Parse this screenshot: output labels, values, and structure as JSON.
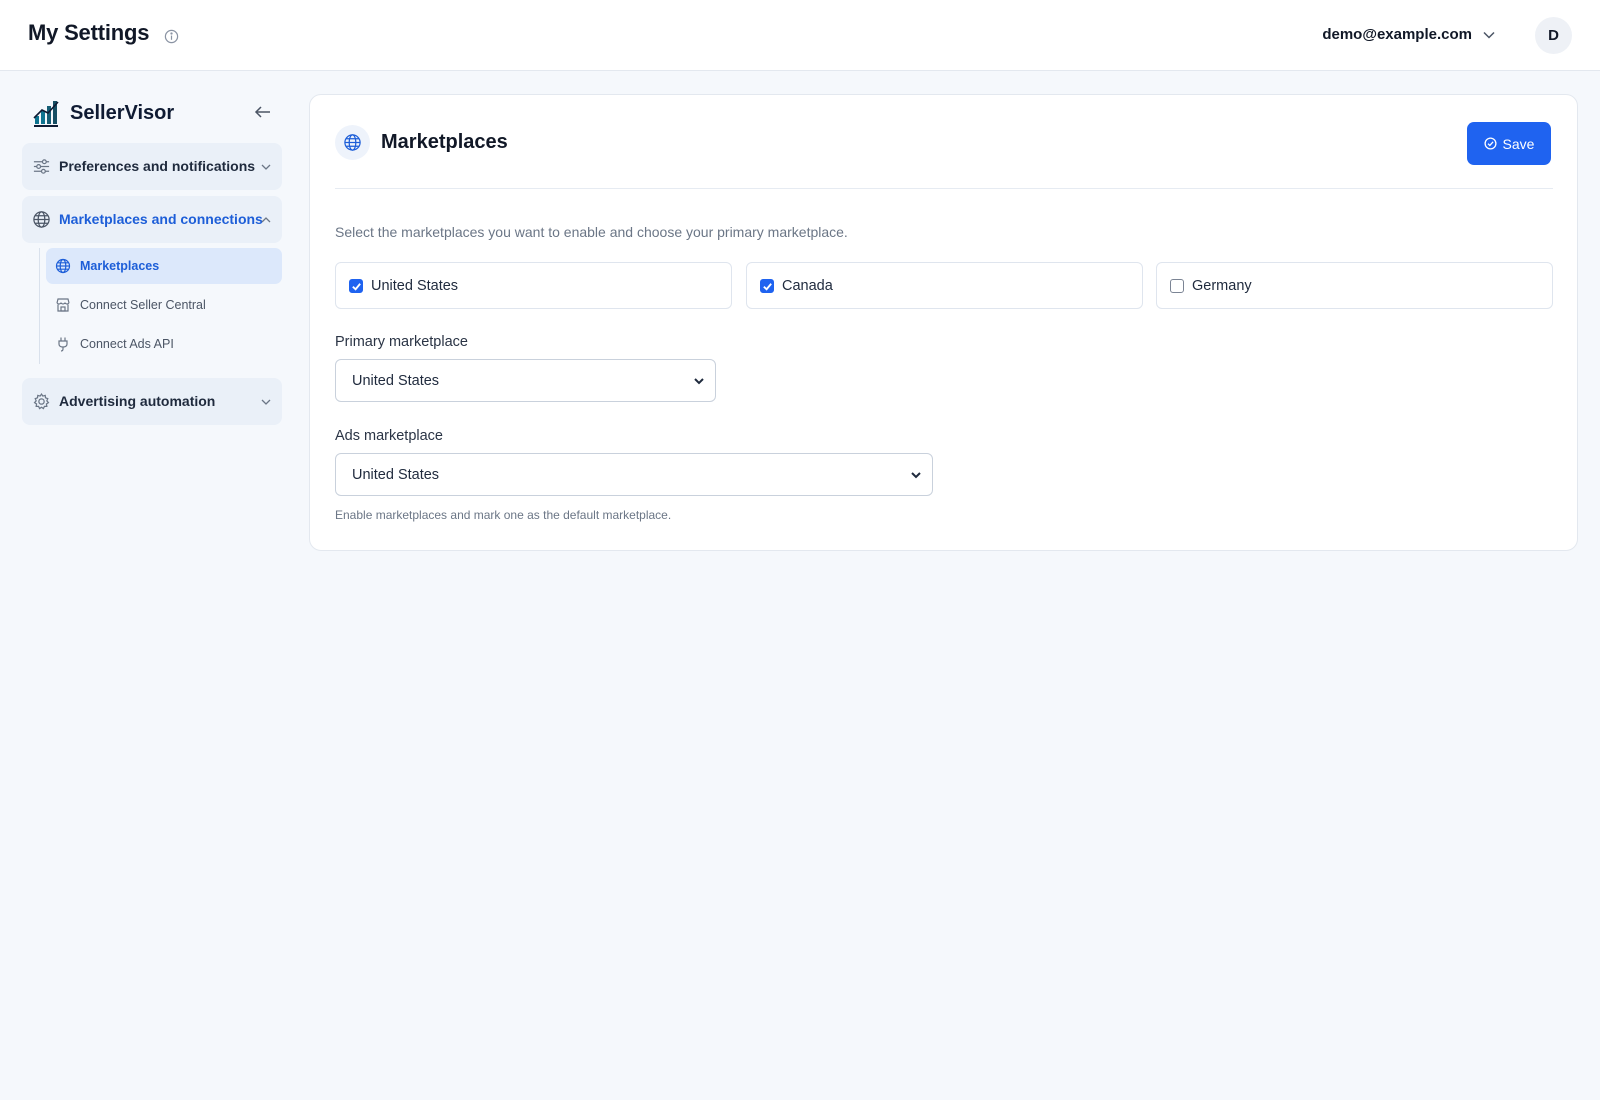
{
  "header": {
    "title": "My Settings",
    "user_email": "demo@example.com",
    "avatar_initial": "D"
  },
  "sidebar": {
    "brand_name": "SellerVisor",
    "groups": [
      {
        "label": "Preferences and notifications",
        "icon": "sliders-icon",
        "expanded": false
      },
      {
        "label": "Marketplaces and connections",
        "icon": "globe-icon",
        "expanded": true
      },
      {
        "label": "Advertising automation",
        "icon": "gear-icon",
        "expanded": false
      }
    ],
    "sub_items": [
      {
        "label": "Marketplaces",
        "icon": "globe-icon",
        "active": true
      },
      {
        "label": "Connect Seller Central",
        "icon": "store-icon",
        "active": false
      },
      {
        "label": "Connect Ads API",
        "icon": "plug-icon",
        "active": false
      }
    ]
  },
  "main": {
    "title": "Marketplaces",
    "save_label": "Save",
    "description": "Select the marketplaces you want to enable and choose your primary marketplace.",
    "marketplaces": [
      {
        "label": "United States",
        "checked": true
      },
      {
        "label": "Canada",
        "checked": true
      },
      {
        "label": "Germany",
        "checked": false
      }
    ],
    "primary_label": "Primary marketplace",
    "primary_value": "United States",
    "ads_label": "Ads marketplace",
    "ads_value": "United States",
    "help_text": "Enable marketplaces and mark one as the default marketplace."
  },
  "colors": {
    "accent": "#1f63f0",
    "active_text": "#1d5ed8",
    "background": "#f5f8fc"
  }
}
